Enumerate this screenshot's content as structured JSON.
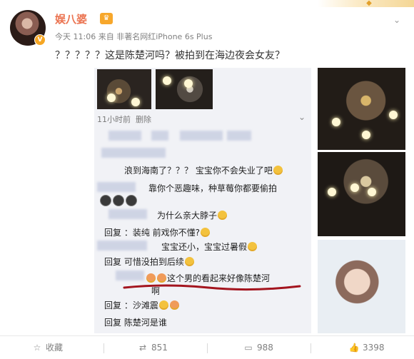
{
  "header": {
    "username": "娱八婆",
    "meta": "今天 11:06 来自 非著名网红iPhone 6s Plus"
  },
  "post": {
    "text": "？？？？？这是陈楚河吗？被拍到在海边夜会女友？"
  },
  "chat": {
    "time": "11小时前",
    "delete": "删除",
    "lines": [
      "浪到海南了？？？ 宝宝你不会失业了吧",
      "靠你个恶趣味，种草莓你都要偷拍",
      "为什么亲大脖子",
      "回复      ：装纯      前戏你不懂?",
      "宝宝还小，宝宝过暑假",
      "回复      可惜没拍到后续",
      "这个男的看起来好像陈楚河",
      "啊",
      "回复      ：沙滩震",
      "回复      陈楚河是谁"
    ]
  },
  "footer": {
    "favorite": "收藏",
    "repost": "851",
    "comment": "988",
    "like": "3398"
  },
  "colors": {
    "username": "#eb7350",
    "meta": "#808080",
    "accent": "#f7a72b"
  }
}
